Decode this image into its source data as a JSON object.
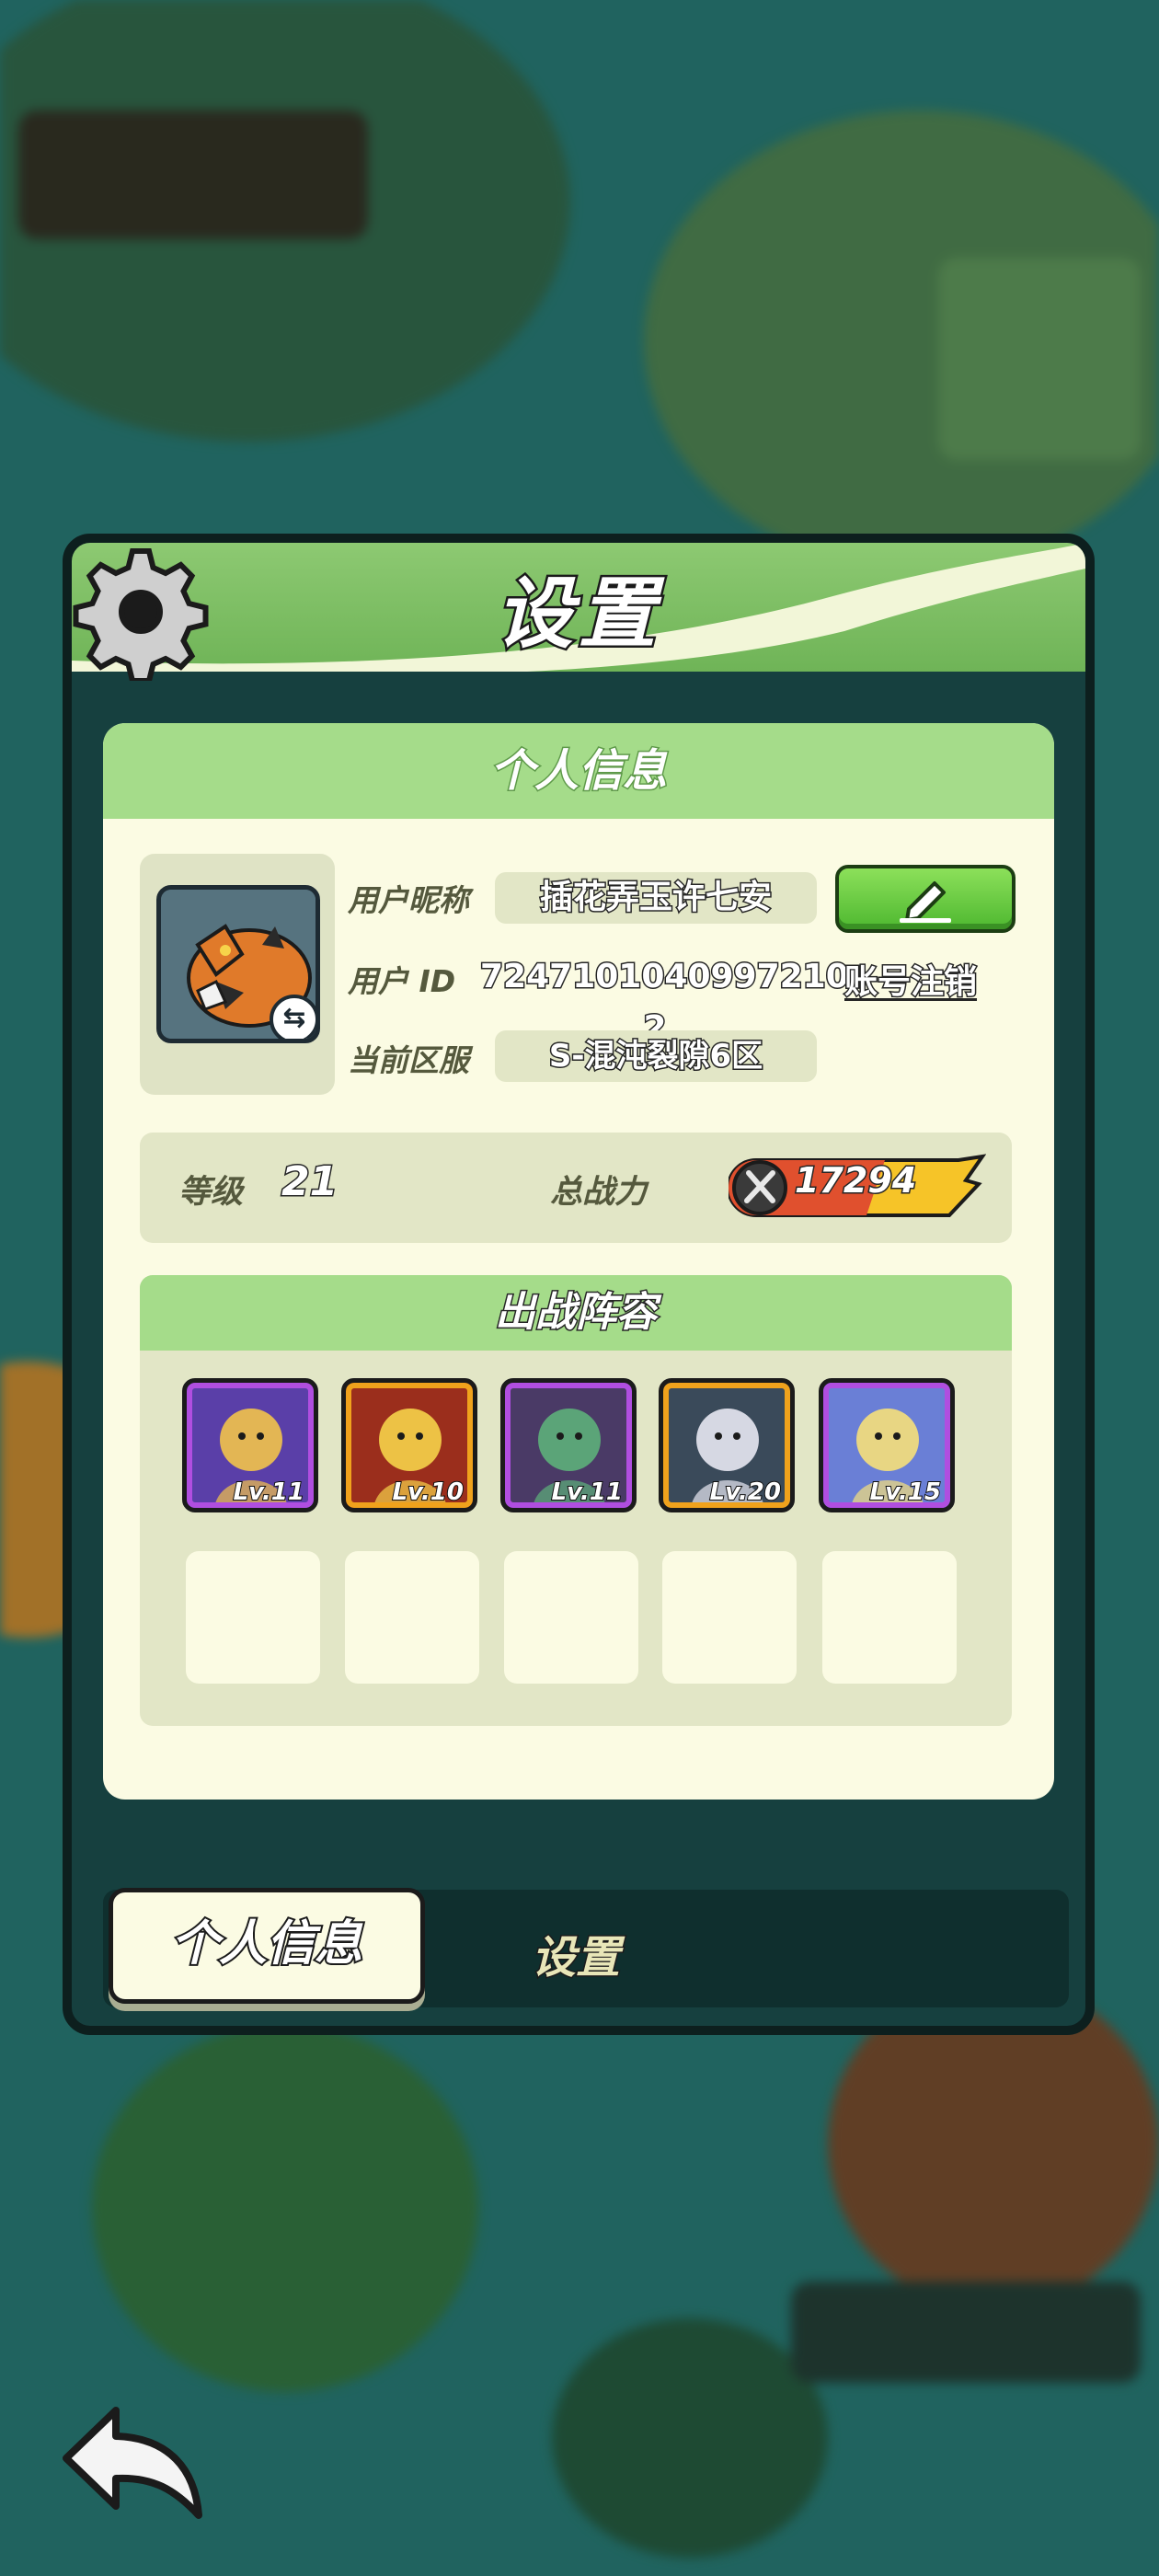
{
  "panel": {
    "title": "设置"
  },
  "card": {
    "title": "个人信息"
  },
  "profile": {
    "nickname_label": "用户昵称",
    "nickname": "插花弄玉许七安",
    "id_label": "用户  ID",
    "user_id": "7247101040997210 2",
    "server_label": "当前区服",
    "server": "S-混沌裂隙6区",
    "cancel_account": "账号注销"
  },
  "stats": {
    "level_label": "等级",
    "level": "21",
    "power_label": "总战力",
    "power": "17294"
  },
  "lineup": {
    "title": "出战阵容",
    "heroes": [
      {
        "level": "Lv.11",
        "rarity_color": "#b04ee0",
        "bg": "#5a3fa8",
        "accent": "#f2c34a"
      },
      {
        "level": "Lv.10",
        "rarity_color": "#f0a21c",
        "bg": "#9b2e1c",
        "accent": "#f6d34a"
      },
      {
        "level": "Lv.11",
        "rarity_color": "#b04ee0",
        "bg": "#4a3a66",
        "accent": "#5db07a"
      },
      {
        "level": "Lv.20",
        "rarity_color": "#f0a21c",
        "bg": "#3a4a5a",
        "accent": "#e8e8f2"
      },
      {
        "level": "Lv.15",
        "rarity_color": "#b04ee0",
        "bg": "#6a7fd6",
        "accent": "#f6e07a"
      }
    ]
  },
  "tabs": {
    "active": "个人信息",
    "inactive": "设置"
  },
  "colors": {
    "panel_green": "#8dc972",
    "card_bg": "#fbfbe3",
    "edit_green": "#5cc23a"
  }
}
